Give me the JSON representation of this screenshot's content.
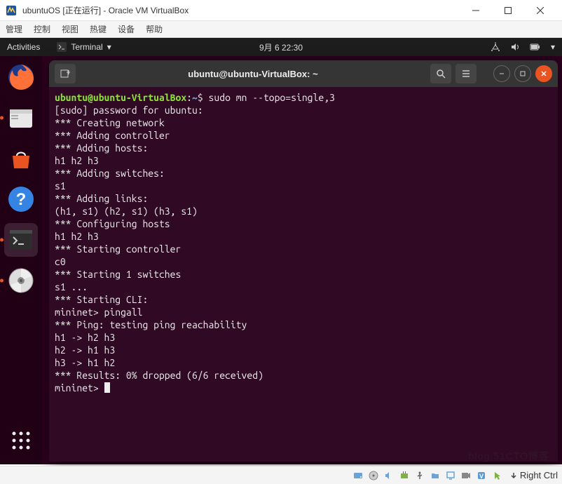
{
  "vb": {
    "title": "ubuntuOS [正在运行] - Oracle VM VirtualBox",
    "menu": [
      "管理",
      "控制",
      "视图",
      "热键",
      "设备",
      "帮助"
    ],
    "hostkey": "Right Ctrl"
  },
  "ubuntu": {
    "activities": "Activities",
    "app_label": "Terminal",
    "clock": "9月 6  22:30"
  },
  "terminal": {
    "title": "ubuntu@ubuntu-VirtualBox: ~",
    "prompt_user": "ubuntu@ubuntu-VirtualBox",
    "prompt_path": "~",
    "command": "sudo mn --topo=single,3",
    "lines": [
      "[sudo] password for ubuntu:",
      "*** Creating network",
      "*** Adding controller",
      "*** Adding hosts:",
      "h1 h2 h3",
      "*** Adding switches:",
      "s1",
      "*** Adding links:",
      "(h1, s1) (h2, s1) (h3, s1)",
      "*** Configuring hosts",
      "h1 h2 h3",
      "*** Starting controller",
      "c0",
      "*** Starting 1 switches",
      "s1 ...",
      "*** Starting CLI:",
      "mininet> pingall",
      "*** Ping: testing ping reachability",
      "h1 -> h2 h3",
      "h2 -> h1 h3",
      "h3 -> h1 h2",
      "*** Results: 0% dropped (6/6 received)",
      "mininet> "
    ]
  },
  "watermark": "blog.51CTO博客"
}
